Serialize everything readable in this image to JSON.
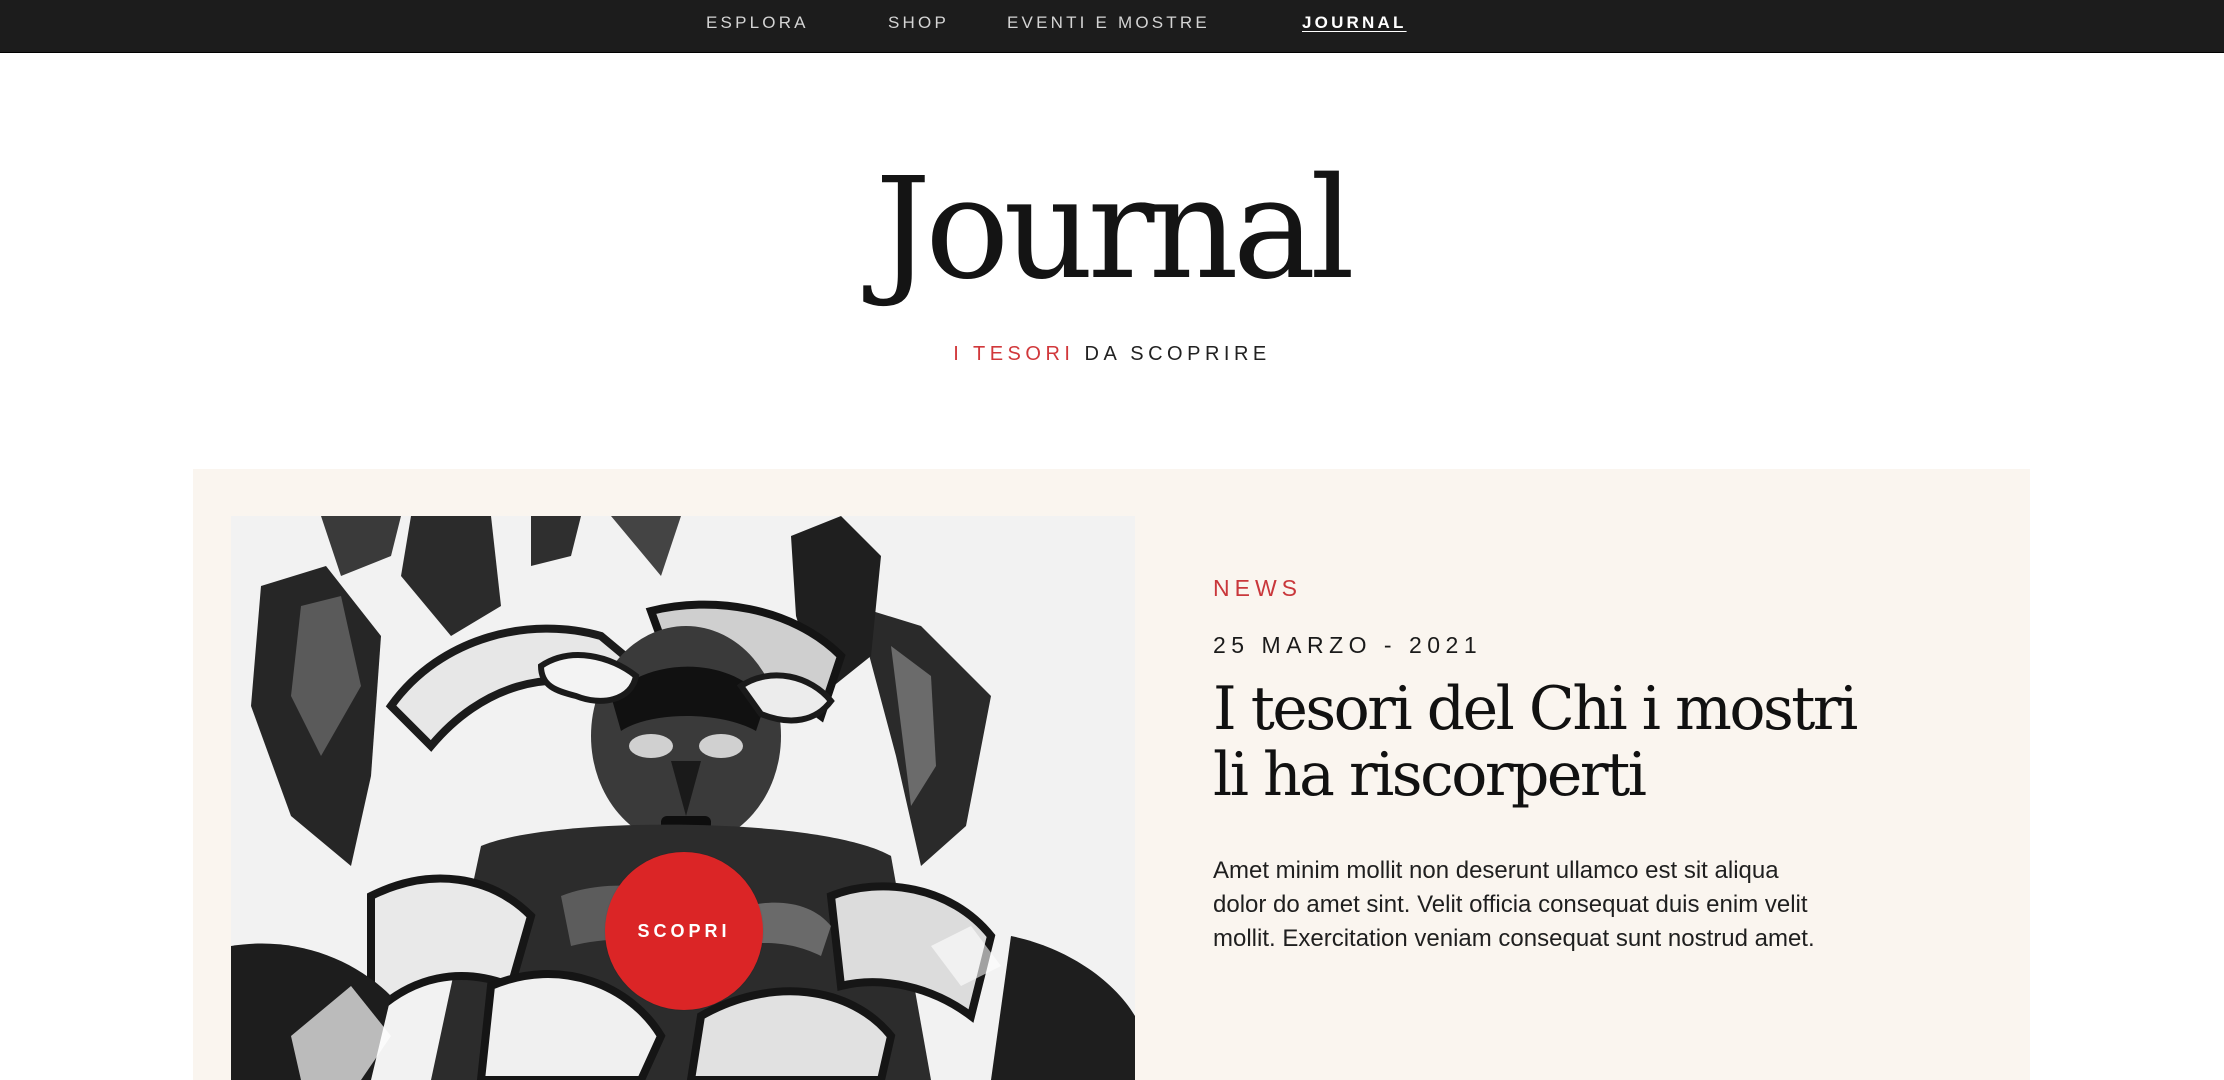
{
  "nav": {
    "items": [
      {
        "label": "ESPLORA"
      },
      {
        "label": "SHOP"
      },
      {
        "label": "EVENTI E MOSTRE"
      },
      {
        "label": "JOURNAL"
      }
    ],
    "active": "JOURNAL"
  },
  "header": {
    "title": "Journal",
    "subtitle_accent": "I TESORI",
    "subtitle_rest": "DA SCOPRIRE"
  },
  "featured": {
    "category": "NEWS",
    "date": "25 MARZO - 2021",
    "title_line1": "I tesori del Chi i mostri",
    "title_line2": "li ha riscorperti",
    "excerpt": "Amet minim mollit non deserunt ullamco est sit aliqua dolor do amet sint. Velit officia consequat duis enim velit mollit. Exercitation veniam consequat sunt nostrud amet.",
    "cta_label": "SCOPRI",
    "image": "black-and-white-sculpture"
  },
  "colors": {
    "nav_bg": "#1c1c1c",
    "accent_red": "#db2526",
    "card_bg": "#faf5ef"
  }
}
